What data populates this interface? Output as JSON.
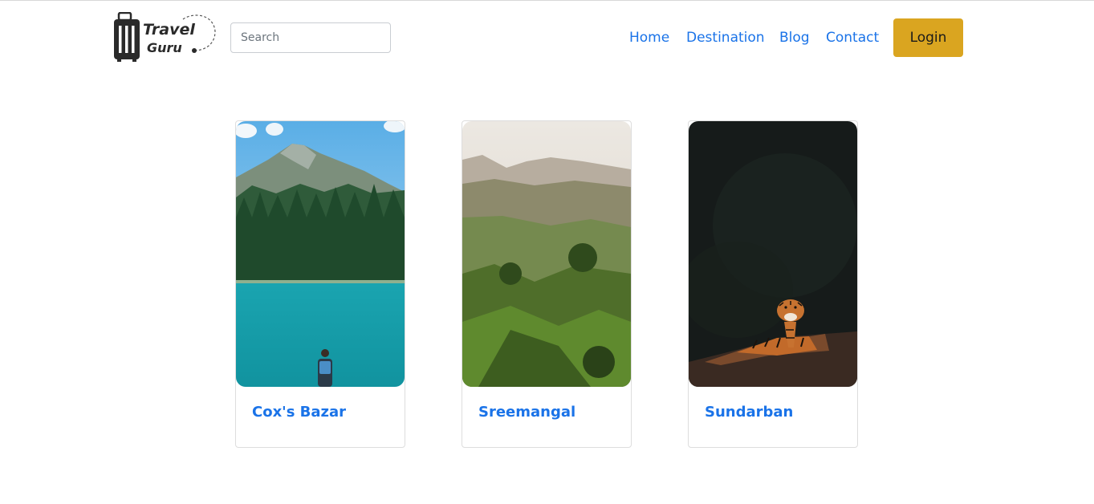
{
  "header": {
    "logo": {
      "line1": "Travel",
      "line2": "Guru"
    },
    "search": {
      "placeholder": "Search",
      "value": ""
    },
    "nav": [
      {
        "label": "Home"
      },
      {
        "label": "Destination"
      },
      {
        "label": "Blog"
      },
      {
        "label": "Contact"
      }
    ],
    "login_label": "Login"
  },
  "colors": {
    "link": "#1a73e8",
    "login_button": "#daa520"
  },
  "destinations": [
    {
      "name": "Cox's Bazar",
      "image": "mountain-lake-photo"
    },
    {
      "name": "Sreemangal",
      "image": "tea-hills-photo"
    },
    {
      "name": "Sundarban",
      "image": "tiger-photo"
    }
  ]
}
